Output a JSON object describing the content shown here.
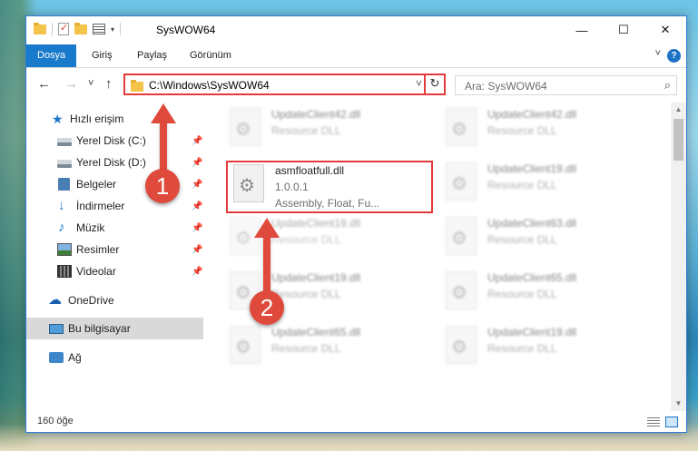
{
  "window": {
    "title": "SysWOW64",
    "minimize": "—",
    "maximize": "☐",
    "close": "✕"
  },
  "ribbon": {
    "tabs": [
      {
        "label": "Dosya",
        "active": true
      },
      {
        "label": "Giriş",
        "active": false
      },
      {
        "label": "Paylaş",
        "active": false
      },
      {
        "label": "Görünüm",
        "active": false
      }
    ],
    "help": "?"
  },
  "nav": {
    "back": "←",
    "forward": "→",
    "recent": "˅",
    "up": "↑",
    "address": "C:\\Windows\\SysWOW64",
    "address_dropdown": "˅",
    "refresh": "↻",
    "search_placeholder": "Ara: SysWOW64",
    "search_icon": "⌕"
  },
  "sidebar": {
    "items": [
      {
        "label": "Hızlı erişim",
        "icon": "star-icon",
        "pinned": false
      },
      {
        "label": "Yerel Disk (C:)",
        "icon": "drive-icon",
        "pinned": true
      },
      {
        "label": "Yerel Disk (D:)",
        "icon": "drive-icon",
        "pinned": true
      },
      {
        "label": "Belgeler",
        "icon": "documents-icon",
        "pinned": true
      },
      {
        "label": "İndirmeler",
        "icon": "download-icon",
        "pinned": true
      },
      {
        "label": "Müzik",
        "icon": "music-icon",
        "pinned": true
      },
      {
        "label": "Resimler",
        "icon": "pictures-icon",
        "pinned": true
      },
      {
        "label": "Videolar",
        "icon": "video-icon",
        "pinned": true
      },
      {
        "label": "OneDrive",
        "icon": "cloud-icon",
        "pinned": false
      },
      {
        "label": "Bu bilgisayar",
        "icon": "computer-icon",
        "pinned": false,
        "selected": true
      },
      {
        "label": "Ağ",
        "icon": "network-icon",
        "pinned": false
      }
    ],
    "pin_glyph": "📌"
  },
  "files": {
    "left": [
      {
        "name": "UpdateClient42.dll",
        "line2": "Resource DLL",
        "line3": ""
      },
      {
        "name": "asmfloatfull.dll",
        "line2": "1.0.0.1",
        "line3": "Assembly, Float, Fu...",
        "highlighted": true
      },
      {
        "name": "UpdateClient19.dll",
        "line2": "Resource DLL",
        "line3": ""
      },
      {
        "name": "UpdateClient19.dll",
        "line2": "Resource DLL",
        "line3": ""
      },
      {
        "name": "UpdateClient65.dll",
        "line2": "Resource DLL",
        "line3": ""
      }
    ],
    "right": [
      {
        "name": "UpdateClient42.dll",
        "line2": "Resource DLL"
      },
      {
        "name": "UpdateClient19.dll",
        "line2": "Resource DLL"
      },
      {
        "name": "UpdateClient63.dll",
        "line2": "Resource DLL"
      },
      {
        "name": "UpdateClient65.dll",
        "line2": "Resource DLL"
      },
      {
        "name": "UpdateClient19.dll",
        "line2": "Resource DLL"
      }
    ]
  },
  "status": {
    "count": "160 öğe"
  },
  "annotations": {
    "step1": "1",
    "step2": "2"
  },
  "colors": {
    "accent": "#1979ca",
    "highlight": "#e53a3a",
    "callout": "#e04a3c"
  }
}
